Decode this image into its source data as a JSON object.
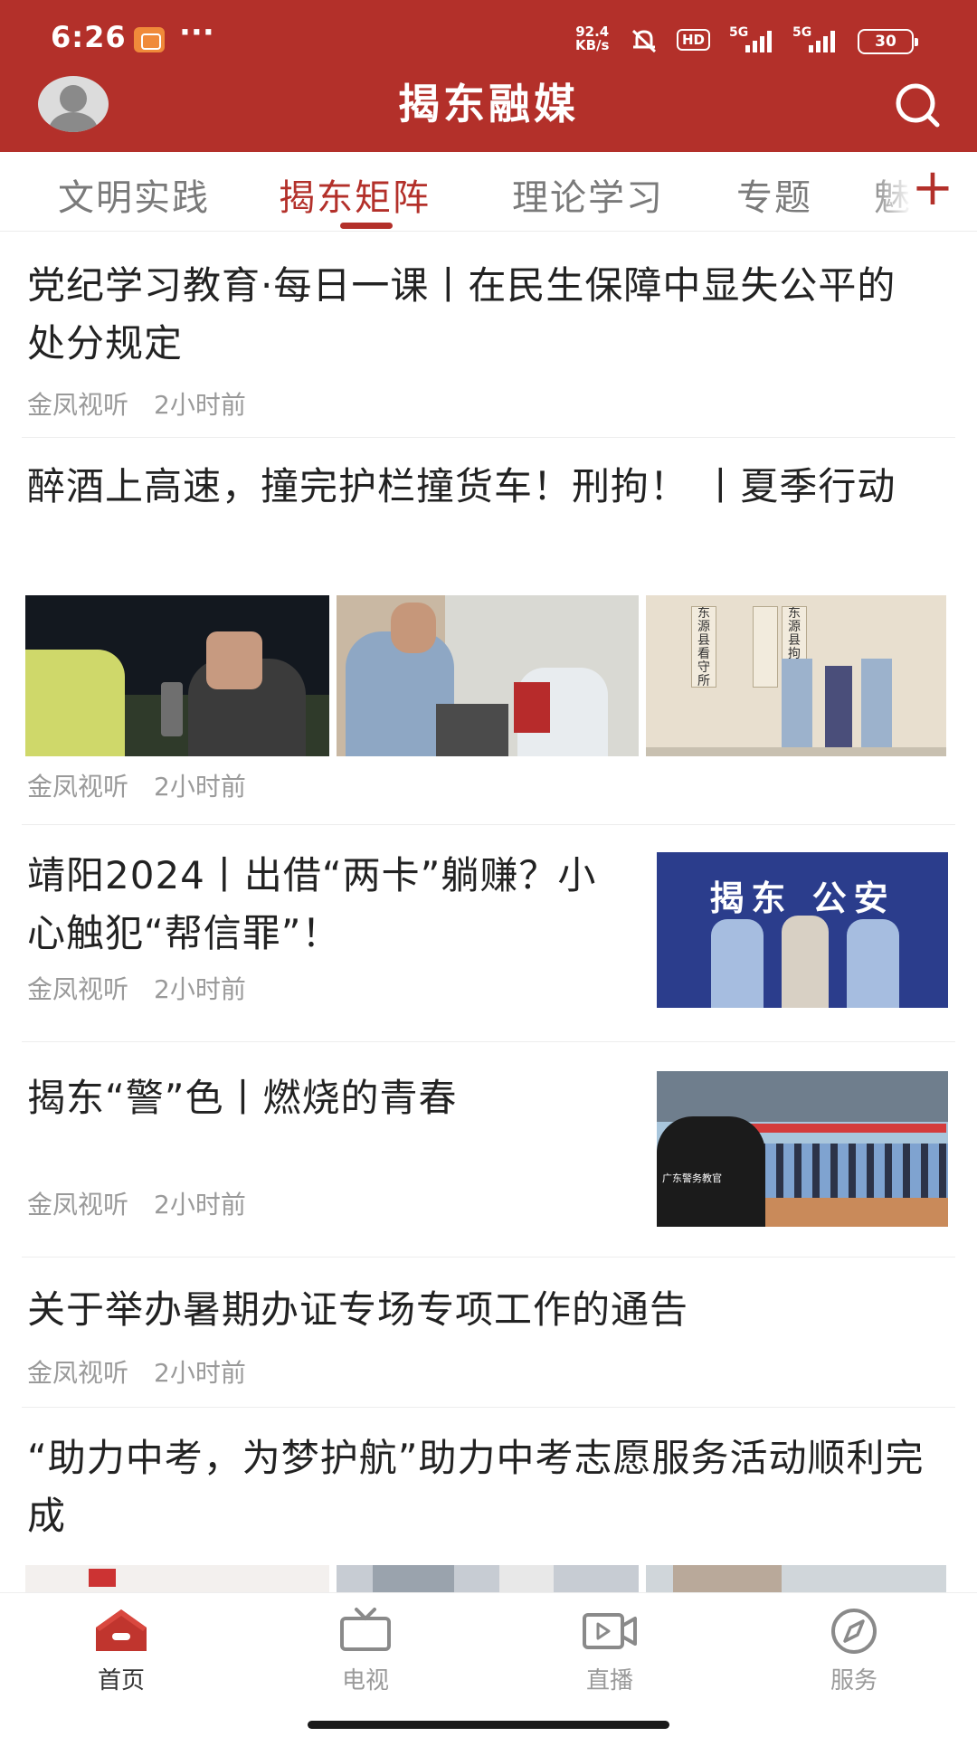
{
  "status_bar": {
    "time": "6:26",
    "more_dots": "···",
    "net_speed_value": "92.4",
    "net_speed_unit": "KB/s",
    "hd_label": "HD",
    "signal_1": "5G",
    "signal_2": "5G",
    "battery": "30"
  },
  "header": {
    "title": "揭东融媒",
    "color": "#b3302a"
  },
  "tabs": [
    {
      "label": "文明实践",
      "active": false
    },
    {
      "label": "揭东矩阵",
      "active": true
    },
    {
      "label": "理论学习",
      "active": false
    },
    {
      "label": "专题",
      "active": false
    },
    {
      "label": "魅",
      "active": false
    }
  ],
  "tab_add_icon": "+",
  "feed": [
    {
      "title": "党纪学习教育·每日一课丨在民生保障中显失公平的处分规定",
      "source": "金凤视听",
      "time": "2小时前"
    },
    {
      "title": "醉酒上高速，撞完护栏撞货车！刑拘！ 丨夏季行动",
      "source": "金凤视听",
      "time": "2小时前",
      "images": [
        "roadside-breathalyzer-photo",
        "police-station-desk-photo",
        "detention-center-sign-photo"
      ],
      "image_sign_texts": [
        "东源县看守所",
        "东源县拘留所"
      ]
    },
    {
      "title": "靖阳2024丨出借“两卡”躺赚？小心触犯“帮信罪”！",
      "source": "金凤视听",
      "time": "2小时前",
      "thumb_text": "揭东 公安"
    },
    {
      "title": "揭东“警”色丨燃烧的青春",
      "source": "金凤视听",
      "time": "2小时前",
      "thumb_text": "广东警务教官"
    },
    {
      "title": "关于举办暑期办证专场专项工作的通告",
      "source": "金凤视听",
      "time": "2小时前"
    },
    {
      "title": "“助力中考，为梦护航”助力中考志愿服务活动顺利完成",
      "images": [
        "volunteer-photo",
        "street-photo",
        "building-photo"
      ]
    }
  ],
  "bottom_nav": [
    {
      "label": "首页",
      "icon": "home-icon",
      "active": true
    },
    {
      "label": "电视",
      "icon": "tv-icon",
      "active": false
    },
    {
      "label": "直播",
      "icon": "live-video-icon",
      "active": false
    },
    {
      "label": "服务",
      "icon": "compass-icon",
      "active": false
    }
  ]
}
